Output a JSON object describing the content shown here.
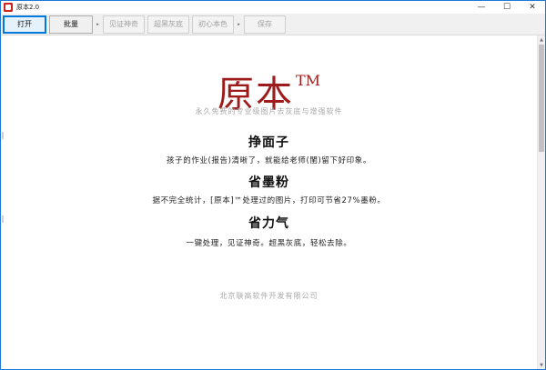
{
  "window": {
    "title": "原本2.0",
    "minimize": "—",
    "maximize": "☐",
    "close": "✕"
  },
  "toolbar": {
    "open_label": "打开",
    "batch_label": "批量",
    "separator_glyph": "▸",
    "verify_label": "见证神奇",
    "dark_to_gray_label": "超黑灰底",
    "original_color_label": "初心本色",
    "save_label": "保存"
  },
  "main": {
    "brand_name": "原本",
    "brand_tm": "TM",
    "tagline": "永久免费的专业级图片去灰底与增强软件",
    "sections": [
      {
        "title": "挣面子",
        "text": "孩子的作业(报告)清晰了，就能给老师(閨)留下好印象。"
      },
      {
        "title": "省墨粉",
        "text": "据不完全统计，[原本]™处理过的图片，打印可节省27%墨粉。"
      },
      {
        "title": "省力气",
        "text": "一键处理，见证神奇。超黑灰底，轻松去除。"
      }
    ],
    "footer": "北京联高软件开发有限公司"
  },
  "scrollbar": {
    "up_glyph": "▲",
    "down_glyph": "▼"
  }
}
